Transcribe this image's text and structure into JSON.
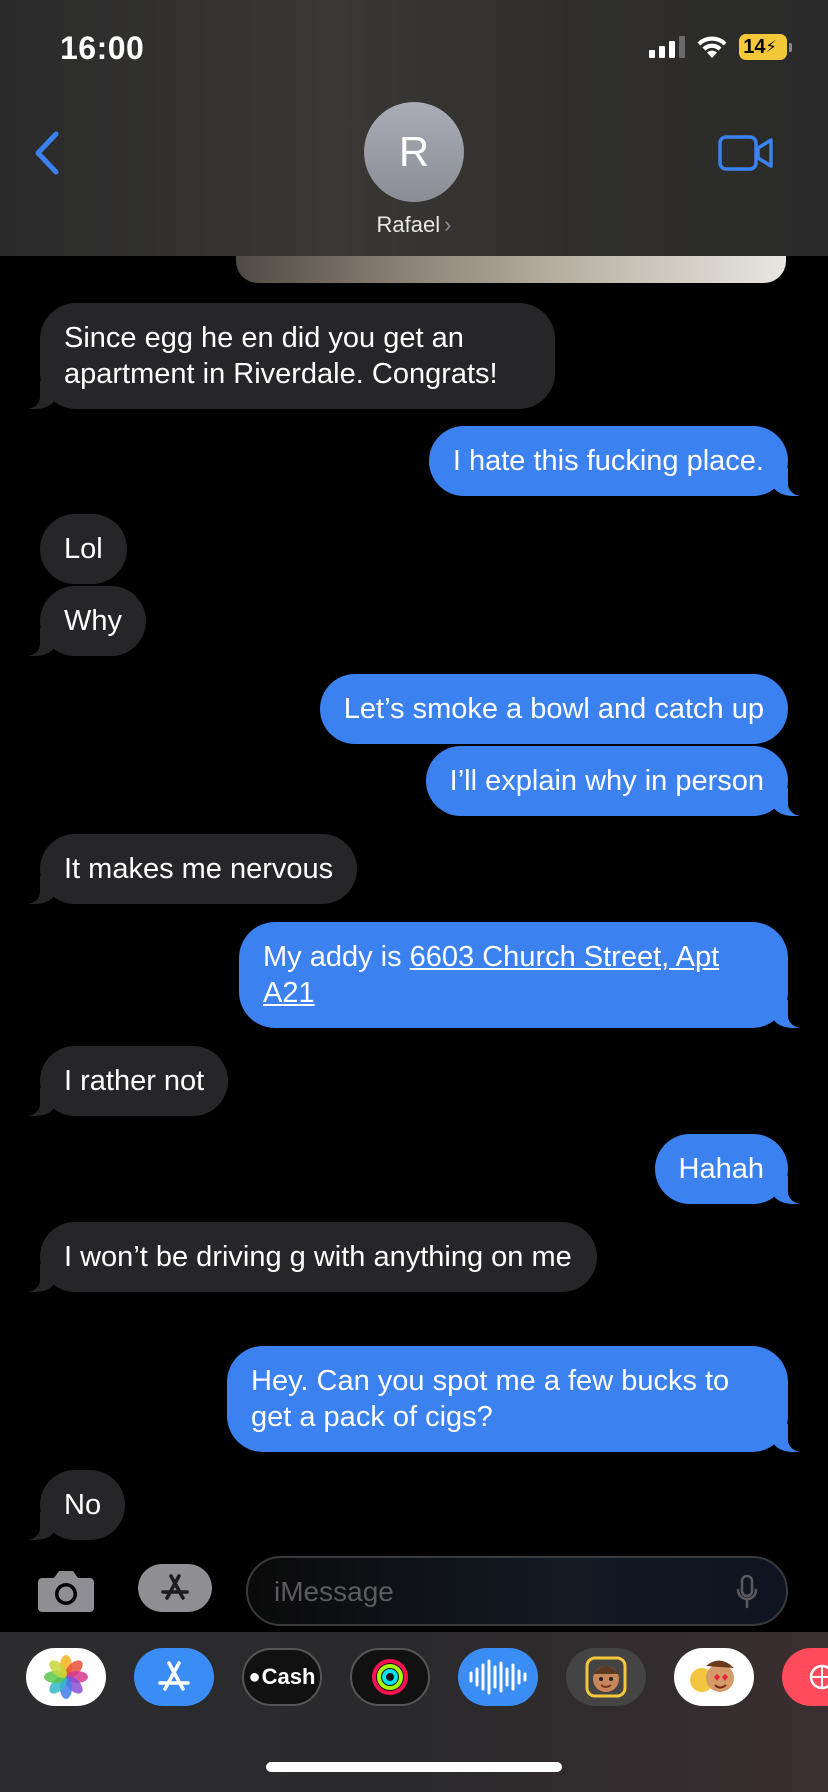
{
  "status_bar": {
    "time": "16:00",
    "battery": "14",
    "battery_color": "#f5c83a"
  },
  "header": {
    "avatar_initial": "R",
    "contact_name": "Rafael",
    "name_chevron": "›",
    "back_icon": "chevron-left-icon",
    "video_icon": "video-camera-icon"
  },
  "messages": [
    {
      "dir": "in",
      "text": "Since egg he en did you get an apartment in Riverdale. Congrats!"
    },
    {
      "dir": "out",
      "text": "I hate this fucking place."
    },
    {
      "dir": "in",
      "text": "Lol"
    },
    {
      "dir": "in",
      "text": "Why"
    },
    {
      "dir": "out",
      "text": "Let’s smoke a bowl and catch up"
    },
    {
      "dir": "out",
      "text": "I’ll explain why in person"
    },
    {
      "dir": "in",
      "text": "It makes me nervous"
    },
    {
      "dir": "out",
      "text_prefix": "My addy is ",
      "link": "6603 Church Street, Apt A21"
    },
    {
      "dir": "in",
      "text": "I rather not"
    },
    {
      "dir": "out",
      "text": "Hahah"
    },
    {
      "dir": "in",
      "text": "I won’t be driving g with  anything on me"
    },
    {
      "dir": "out",
      "text": "Hey. Can you spot me a few bucks to get a pack of cigs?"
    },
    {
      "dir": "in",
      "text": "No"
    }
  ],
  "input": {
    "placeholder": "iMessage",
    "camera_icon": "camera-icon",
    "apps_icon": "app-store-icon",
    "mic_icon": "microphone-icon"
  },
  "app_drawer": {
    "apps": [
      "photos",
      "app-store",
      "apple-cash",
      "fitness",
      "audio-message",
      "memoji",
      "memoji-stickers",
      "more"
    ],
    "cash_label": "Cash"
  },
  "colors": {
    "outgoing": "#3b82f0",
    "incoming": "#262628",
    "accent": "#3b82f0"
  }
}
